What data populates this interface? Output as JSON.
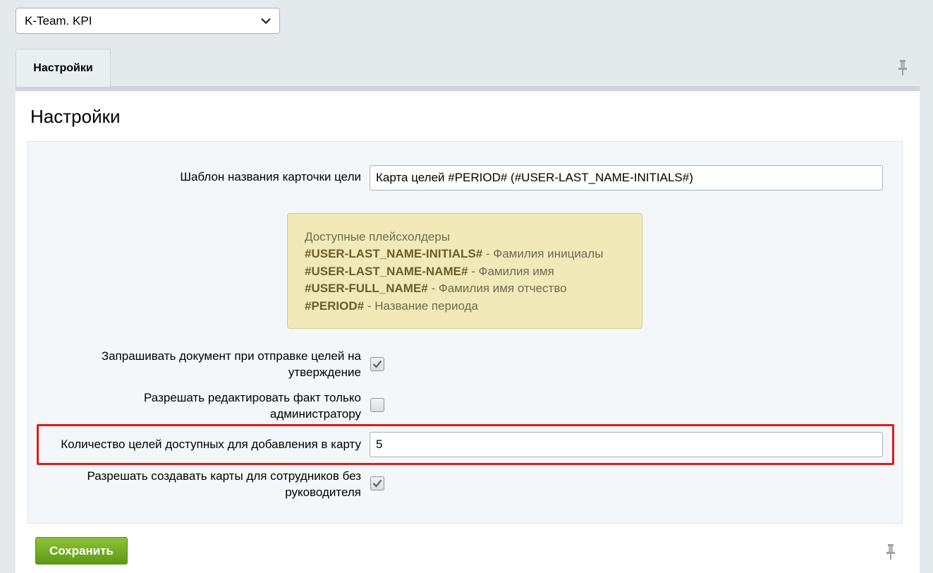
{
  "module_select": {
    "value": "K-Team. KPI"
  },
  "tabs": [
    {
      "label": "Настройки"
    }
  ],
  "panel": {
    "title": "Настройки"
  },
  "fields": {
    "card_name_template": {
      "label": "Шаблон названия карточки цели",
      "value": "Карта целей #PERIOD# (#USER-LAST_NAME-INITIALS#)"
    },
    "placeholders_hint": {
      "title": "Доступные плейсхолдеры",
      "items": [
        {
          "code": "#USER-LAST_NAME-INITIALS#",
          "desc": " - Фамилия инициалы"
        },
        {
          "code": "#USER-LAST_NAME-NAME#",
          "desc": " - Фамилия имя"
        },
        {
          "code": "#USER-FULL_NAME#",
          "desc": " - Фамилия имя отчество"
        },
        {
          "code": "#PERIOD#",
          "desc": " - Название периода"
        }
      ]
    },
    "request_document": {
      "label_line1": "Запрашивать документ при отправке целей на",
      "label_line2": "утверждение",
      "checked": true
    },
    "edit_fact_admin_only": {
      "label_line1": "Разрешать редактировать факт только",
      "label_line2": "администратору",
      "checked": false
    },
    "goals_count": {
      "label": "Количество целей доступных для добавления в карту",
      "value": "5"
    },
    "maps_without_manager": {
      "label_line1": "Разрешать создавать карты для сотрудников без",
      "label_line2": "руководителя",
      "checked": true
    }
  },
  "save_button": {
    "label": "Сохранить"
  },
  "colors": {
    "highlight": "#e01a1a",
    "save_button": "#6fa91f",
    "hint_background": "#f1eab8"
  }
}
